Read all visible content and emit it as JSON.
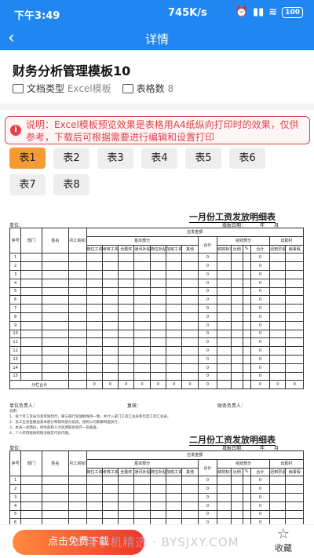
{
  "status": {
    "time": "下午3:49",
    "network": "745K/s",
    "battery": "100"
  },
  "nav": {
    "back_icon": "chevron-left",
    "title": "详情"
  },
  "doc": {
    "title": "财务分析管理模板10",
    "type_label": "文档类型",
    "type_value": "Excel模板",
    "count_label": "表格数",
    "count_value": "8"
  },
  "notice": {
    "icon": "i",
    "text": "说明：Excel模板预览效果是表格用A4纸纵向打印时的效果，仅供参考，下载后可根据需要进行编辑和设置打印"
  },
  "tabs": [
    "表1",
    "表2",
    "表3",
    "表4",
    "表5",
    "表6",
    "表7",
    "表8"
  ],
  "active_tab": 0,
  "sheet1": {
    "title": "一月份工资发放明细表",
    "date_line": "填报日期：______年____月____",
    "unit": "单位：",
    "headers": {
      "seq": "序号",
      "dept": "部门",
      "name": "姓名",
      "base": "月工资标准",
      "payable": "应发金额",
      "basic": "基本部分",
      "perf": "绩效部分",
      "attend": "出勤村",
      "cols": [
        "岗位工资",
        "考核工资",
        "全勤奖",
        "通讯补贴",
        "岗位补贴",
        "加班工资",
        "其他",
        "合计",
        "绩效标准",
        "比例",
        "%",
        "合计",
        "迟到早退",
        "病事假"
      ]
    },
    "rows": [
      "1",
      "2",
      "3",
      "4",
      "5",
      "6",
      "7",
      "8",
      "9",
      "10",
      "11",
      "12",
      "13",
      "14",
      "15"
    ],
    "zero": "0",
    "total_label": "分栏合计",
    "sign": [
      "单位负责人：",
      "复核：",
      "财务负责人："
    ],
    "notes_title": "说明：",
    "notes": [
      "1、每个月工资表均须单独列示，要与银行发放额保持一致，并计入部门工资汇总表和年度工资汇总表。",
      "2、员工应发金额由基本部分和绩效部分组成，按照公司薪酬制度执行。",
      "3、本表一式两份，财务部和人力资源部各留存一份备查。",
      "4、个人所得税按照税法规定代扣代缴。"
    ]
  },
  "sheet2": {
    "title": "二月份工资发放明细表",
    "date_line": "填报日期：______年____月____",
    "unit": "单位："
  },
  "bottom": {
    "download": "点击免费下载",
    "fav": "收藏",
    "fav_icon": "star"
  },
  "watermark": "3 用手机精选 · BYSJXY.COM"
}
